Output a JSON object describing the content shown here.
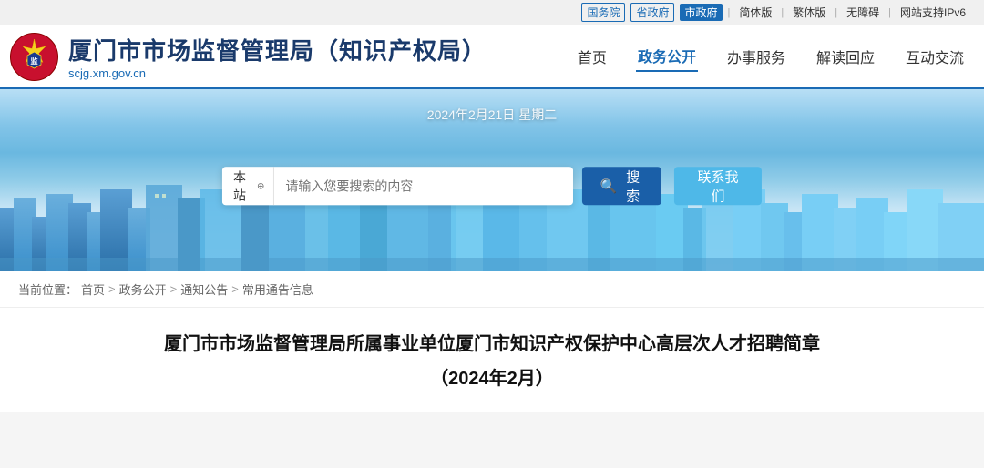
{
  "topbar": {
    "links": [
      {
        "label": "国务院",
        "style": "boxed"
      },
      {
        "label": "省政府",
        "style": "boxed"
      },
      {
        "label": "市政府",
        "style": "active"
      },
      {
        "label": "简体版",
        "style": "normal"
      },
      {
        "label": "繁体版",
        "style": "normal"
      },
      {
        "label": "无障碍",
        "style": "normal"
      },
      {
        "label": "网站支持IPv6",
        "style": "normal"
      }
    ]
  },
  "header": {
    "title_main": "厦门市市场监督管理局（知识产权局）",
    "title_sub": "scjg.xm.gov.cn",
    "nav": [
      {
        "label": "首页",
        "active": false
      },
      {
        "label": "政务公开",
        "active": true
      },
      {
        "label": "办事服务",
        "active": false
      },
      {
        "label": "解读回应",
        "active": false
      },
      {
        "label": "互动交流",
        "active": false
      }
    ]
  },
  "banner": {
    "date": "2024年2月21日 星期二",
    "search_scope": "本站",
    "search_placeholder": "请输入您要搜索的内容",
    "search_btn_label": "搜索",
    "contact_btn_label": "联系我们"
  },
  "breadcrumb": {
    "items": [
      "首页",
      "政务公开",
      "通知公告",
      "常用通告信息"
    ],
    "label": "当前位置："
  },
  "article": {
    "title_line1": "厦门市市场监督管理局所属事业单位厦门市知识产权保护中心高层次人才招聘简章",
    "title_line2": "（2024年2月）"
  },
  "icons": {
    "search": "🔍",
    "dropdown": "⊕"
  }
}
